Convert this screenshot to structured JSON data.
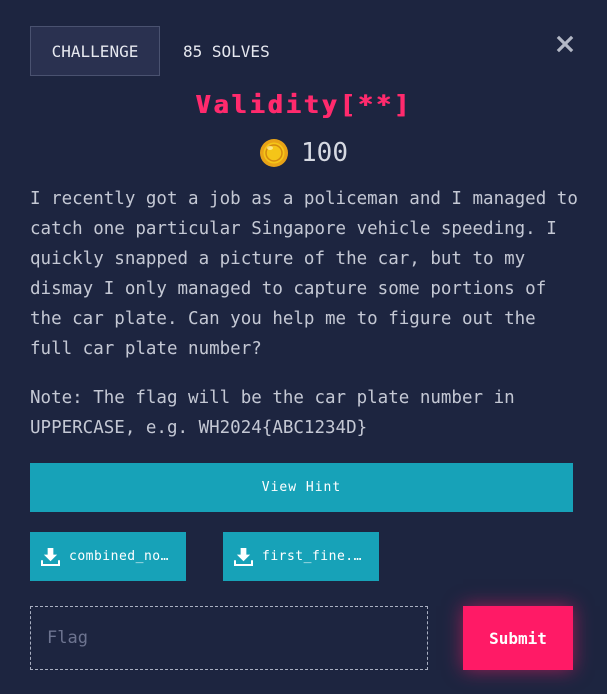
{
  "header": {
    "tab_label": "CHALLENGE",
    "solves": "85 SOLVES"
  },
  "challenge": {
    "title": "Validity[**]",
    "points": "100",
    "description": "I recently got a job as a policeman and I managed to catch one particular Singapore vehicle speeding. I quickly snapped a picture of the car, but to my dismay I only managed to capture some portions of the car plate. Can you help me to figure out the full car plate number?",
    "note": "Note: The flag will be the car plate number in UPPERCASE, e.g. WH2024{ABC1234D}"
  },
  "hint": {
    "label": "View Hint"
  },
  "files": [
    {
      "label": "combined_no…",
      "icon": "download-icon"
    },
    {
      "label": "first_fine.…",
      "icon": "download-icon"
    }
  ],
  "submission": {
    "placeholder": "Flag",
    "submit_label": "Submit"
  },
  "colors": {
    "background": "#1d2540",
    "title": "#ff2a6d",
    "accent": "#17a2b8",
    "submit": "#ff1a66"
  }
}
